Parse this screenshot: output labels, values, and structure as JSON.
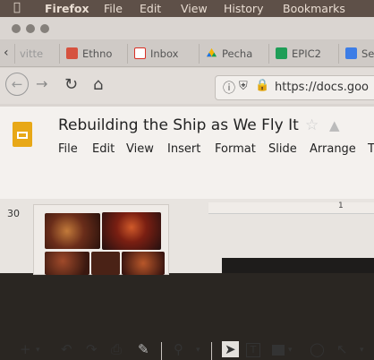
{
  "menubar": {
    "apple_icon": "apple-icon",
    "items": [
      "Firefox",
      "File",
      "Edit",
      "View",
      "History",
      "Bookmarks"
    ]
  },
  "tabs": [
    {
      "label": "vitte",
      "icon": "page-icon"
    },
    {
      "label": "Ethno",
      "icon": "mail-red-icon"
    },
    {
      "label": "Inbox",
      "icon": "gmail-icon"
    },
    {
      "label": "Pecha",
      "icon": "drive-icon"
    },
    {
      "label": "EPIC2",
      "icon": "sheets-icon"
    },
    {
      "label": "Se",
      "icon": "docs-icon"
    }
  ],
  "nav": {
    "url": "https://docs.goo"
  },
  "doc": {
    "title": "Rebuilding the Ship as We Fly It",
    "menu": [
      "File",
      "Edit",
      "View",
      "Insert",
      "Format",
      "Slide",
      "Arrange",
      "T"
    ]
  },
  "slides": {
    "number": "30",
    "ruler_mark": "1"
  },
  "colors": {
    "slides_yellow": "#e8a817",
    "gmail_red": "#d93025",
    "sheets_green": "#1f9e57",
    "docs_blue": "#3d7de6",
    "lock_green": "#2e9e45"
  }
}
